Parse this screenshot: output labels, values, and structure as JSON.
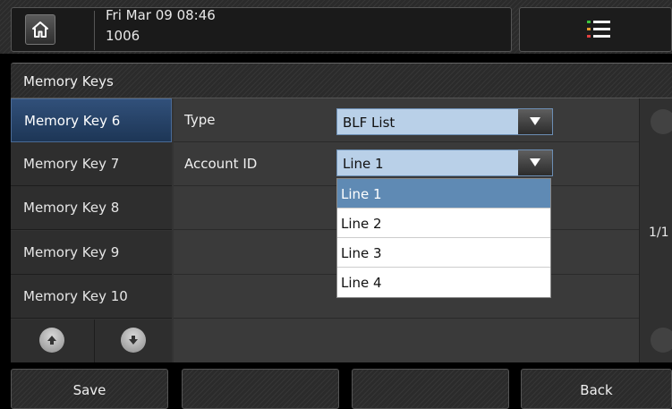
{
  "status_bar": {
    "datetime": "Fri Mar 09 08:46",
    "extension": "1006"
  },
  "page_title": "Memory Keys",
  "memory_keys": [
    {
      "label": "Memory Key 6",
      "selected": true
    },
    {
      "label": "Memory Key 7",
      "selected": false
    },
    {
      "label": "Memory Key 8",
      "selected": false
    },
    {
      "label": "Memory Key 9",
      "selected": false
    },
    {
      "label": "Memory Key 10",
      "selected": false
    }
  ],
  "fields": {
    "type_label": "Type",
    "type_value": "BLF List",
    "account_label": "Account ID",
    "account_value": "Line 1"
  },
  "account_options": [
    "Line 1",
    "Line 2",
    "Line 3",
    "Line 4"
  ],
  "pagination": "1/1",
  "softkeys": {
    "save": "Save",
    "empty1": "",
    "empty2": "",
    "back": "Back"
  },
  "colors": {
    "selection": "#31507a",
    "select_field": "#b9d0e8",
    "dropdown_active": "#5f8ab4",
    "menu_icon_accent_green": "#3ec43e",
    "menu_icon_accent_orange": "#e59a2b"
  },
  "icons": {
    "home": "home-icon",
    "menu": "menu-list-icon",
    "up": "arrow-up-icon",
    "down": "arrow-down-icon"
  }
}
